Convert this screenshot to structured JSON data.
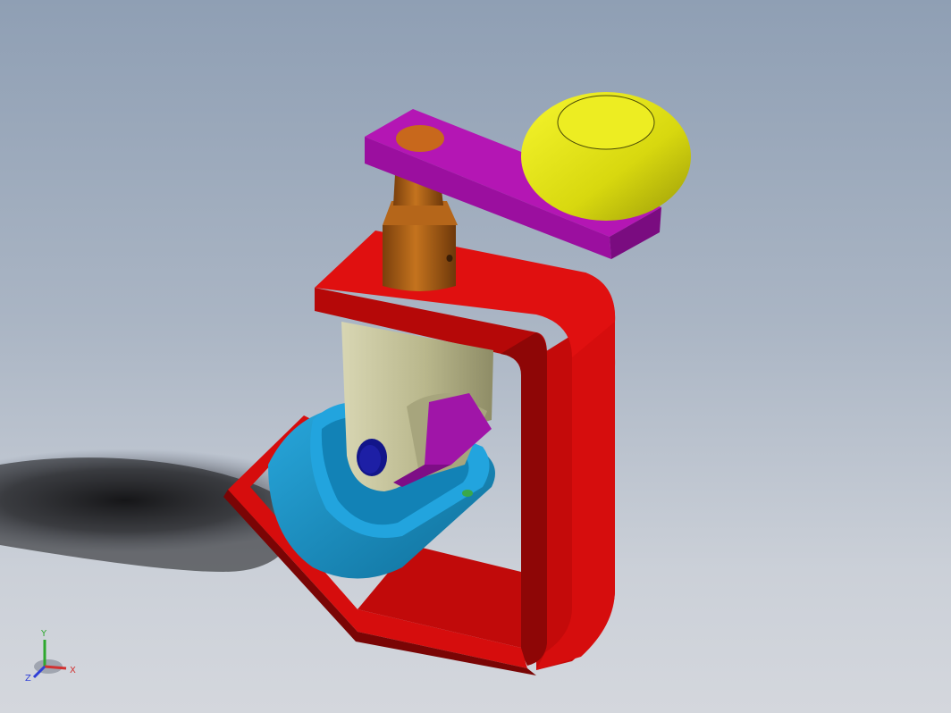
{
  "viewport": {
    "background_top": "#8f9fb4",
    "background_bottom": "#d4d7dd"
  },
  "model": {
    "frame_color": "#d20d0d",
    "handle_color": "#a010a0",
    "knob_color": "#e3e313",
    "screw_color": "#a05a14",
    "swivel_color": "#bdbb92",
    "pad_color": "#1893c8"
  },
  "triad": {
    "x_label": "X",
    "y_label": "Y",
    "z_label": "Z",
    "x_color": "#d23232",
    "y_color": "#2ea82e",
    "z_color": "#2f3fd6"
  }
}
